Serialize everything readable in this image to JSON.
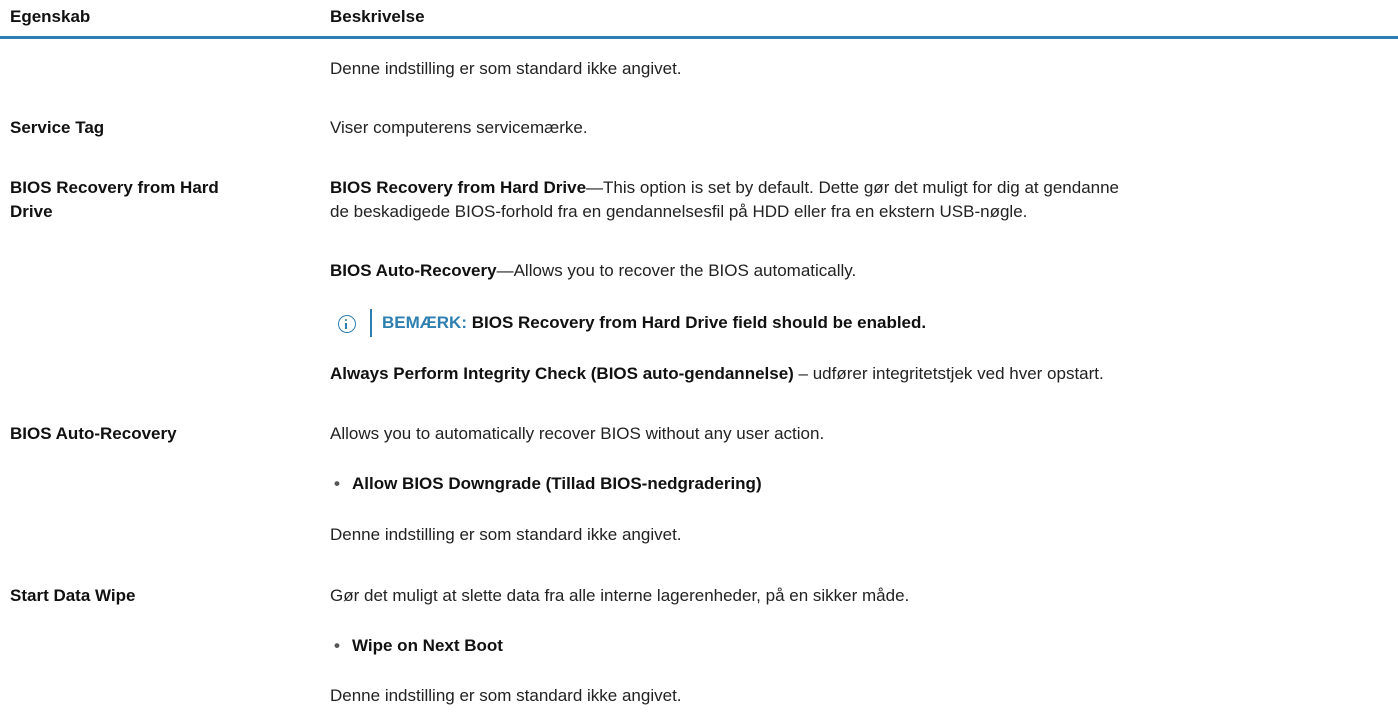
{
  "table": {
    "headers": {
      "property": "Egenskab",
      "description": "Beskrivelse"
    },
    "rows": [
      {
        "description": "Denne indstilling er som standard ikke angivet."
      },
      {
        "property": "Service Tag",
        "description": "Viser computerens servicemærke."
      },
      {
        "property_line1": "BIOS Recovery from Hard",
        "property_line2": "Drive",
        "p1_bold": "BIOS Recovery from Hard Drive",
        "p1_text_line1": "—This option is set by default. Dette gør det muligt for dig at gendanne",
        "p1_text_line2": "de beskadigede BIOS-forhold fra en gendannelsesfil på HDD eller fra en ekstern USB-nøgle.",
        "p2_bold": "BIOS Auto-Recovery",
        "p2_text": "—Allows you to recover the BIOS automatically.",
        "note_label": "BEMÆRK:",
        "note_text": " BIOS Recovery from Hard Drive field should be enabled.",
        "p3_bold": "Always Perform Integrity Check (BIOS auto-gendannelse)",
        "p3_text": " – udfører integritetstjek ved hver opstart."
      },
      {
        "property": "BIOS Auto-Recovery",
        "description": "Allows you to automatically recover BIOS without any user action.",
        "bullet": "Allow BIOS Downgrade (Tillad BIOS-nedgradering)",
        "after": "Denne indstilling er som standard ikke angivet."
      },
      {
        "property": "Start Data Wipe",
        "description": "Gør det muligt at slette data fra alle interne lagerenheder, på en sikker måde.",
        "bullet": "Wipe on Next Boot",
        "after": "Denne indstilling er som standard ikke angivet."
      }
    ],
    "bullet_symbol": "•"
  },
  "colors": {
    "accent": "#2e7fb1",
    "text": "#222222"
  },
  "icons": {
    "note": "info-circle-icon"
  }
}
